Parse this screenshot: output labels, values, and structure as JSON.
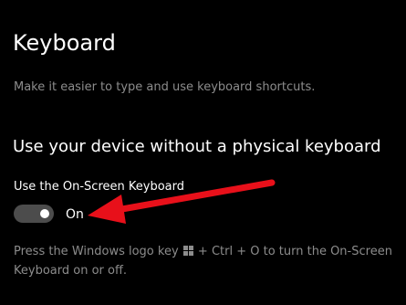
{
  "page": {
    "title": "Keyboard",
    "description": "Make it easier to type and use keyboard shortcuts."
  },
  "section": {
    "heading": "Use your device without a physical keyboard"
  },
  "on_screen_keyboard": {
    "label": "Use the On-Screen Keyboard",
    "toggle_state": "On",
    "enabled": true,
    "help_before_icon": "Press the Windows logo key",
    "help_icon": "windows-logo-icon",
    "help_after_icon": "+ Ctrl + O to turn the On-Screen Keyboard on or off."
  },
  "annotation": {
    "arrow_color": "#e8101a"
  },
  "colors": {
    "background": "#000000",
    "primary_text": "#ffffff",
    "secondary_text": "#8c8c8c",
    "toggle_track": "#4c4c4c",
    "toggle_knob": "#ffffff"
  }
}
